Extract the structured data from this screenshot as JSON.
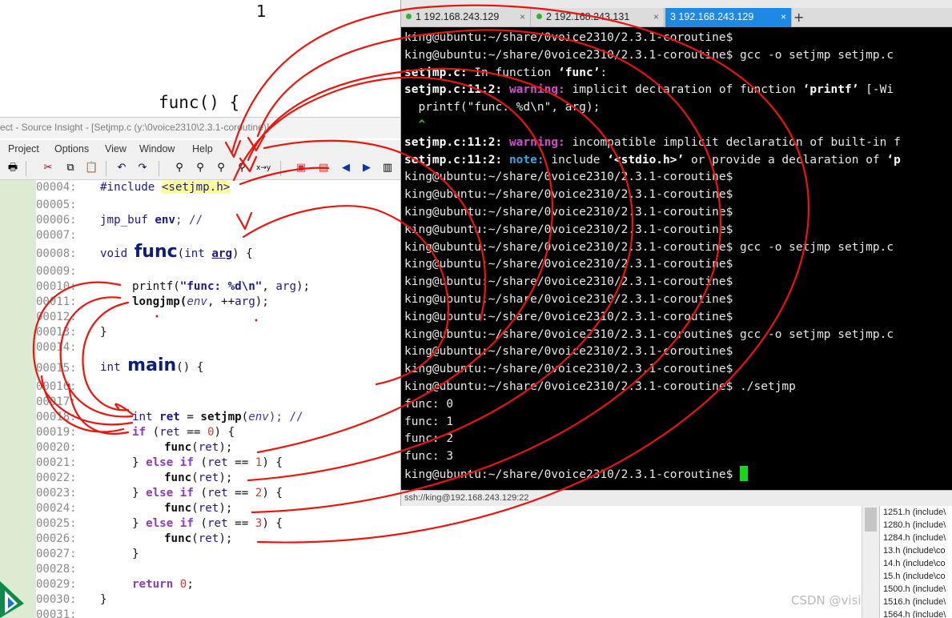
{
  "whiteboard": {
    "one": "1",
    "func_label": "func() {"
  },
  "source_insight": {
    "title": "ect - Source Insight - [Setjmp.c (y:\\0voice2310\\2.3.1-coroutine)]",
    "menu": [
      "Project",
      "Options",
      "View",
      "Window",
      "Help"
    ],
    "line_numbers": [
      "00004:",
      "00005:",
      "00006:",
      "00007:",
      "00008:",
      "00009:",
      "00010:",
      "00011:",
      "00012:",
      "00013:",
      "00014:",
      "00015:",
      "00016:",
      "00017:",
      "00018:",
      "00019:",
      "00020:",
      "00021:",
      "00022:",
      "00023:",
      "00024:",
      "00025:",
      "00026:",
      "00027:",
      "00028:",
      "00029:",
      "00030:",
      "00031:"
    ],
    "code": {
      "l4_a": "#include ",
      "l4_b": "<setjmp.h>",
      "l6_a": "jmp_buf ",
      "l6_b": "env",
      "l6_c": "; //",
      "l8_a": "void ",
      "l8_b": "func",
      "l8_c": "(",
      "l8_d": "int ",
      "l8_e": "arg",
      "l8_f": ") {",
      "l10_a": "printf(",
      "l10_b": "\"func: %d\\n\"",
      "l10_c": ", ",
      "l10_d": "arg",
      "l10_e": ");",
      "l11_a": "longjmp(",
      "l11_b": "env",
      "l11_c": ", ++",
      "l11_d": "arg",
      "l11_e": ");",
      "l13": "}",
      "l15_a": "int ",
      "l15_b": "main",
      "l15_c": "() {",
      "l18_a": "int ",
      "l18_b": "ret",
      "l18_c": " = ",
      "l18_d": "setjmp",
      "l18_e": "(",
      "l18_f": "env",
      "l18_g": "); //",
      "l19_a": "if",
      "l19_b": " (",
      "l19_c": "ret",
      "l19_d": " == ",
      "l19_e": "0",
      "l19_f": ") {",
      "l20_a": "func",
      "l20_b": "(",
      "l20_c": "ret",
      "l20_d": ");",
      "l21_a": "} ",
      "l21_b": "else if",
      "l21_c": " (",
      "l21_d": "ret",
      "l21_e": " == ",
      "l21_f": "1",
      "l21_g": ") {",
      "l22_a": "func",
      "l22_b": "(",
      "l22_c": "ret",
      "l22_d": ");",
      "l23_a": "} ",
      "l23_b": "else if",
      "l23_c": " (",
      "l23_d": "ret",
      "l23_e": " == ",
      "l23_f": "2",
      "l23_g": ") {",
      "l24_a": "func",
      "l24_b": "(",
      "l24_c": "ret",
      "l24_d": ");",
      "l25_a": "} ",
      "l25_b": "else if",
      "l25_c": " (",
      "l25_d": "ret",
      "l25_e": " == ",
      "l25_f": "3",
      "l25_g": ") {",
      "l26_a": "func",
      "l26_b": "(",
      "l26_c": "ret",
      "l26_d": ");",
      "l27": "}",
      "l29_a": "return ",
      "l29_b": "0",
      "l29_c": ";",
      "l30": "}"
    }
  },
  "terminal": {
    "tabs": [
      {
        "label": "1 192.168.243.129",
        "status_color": "#2db52d"
      },
      {
        "label": "2 192.168.243.131",
        "status_color": "#2db52d"
      },
      {
        "label": "3 192.168.243.129",
        "status_color": "#ffffff"
      }
    ],
    "tab_close": "×",
    "tab_add": "+",
    "prompt": "king@ubuntu:~/share/0voice2310/2.3.1-coroutine$",
    "cmd_gcc": " gcc -o setjmp setjmp.c",
    "cmd_run": " ./setjmp",
    "w1_file": "setjmp.c:",
    "w1_msg": " In function ",
    "w1_fn": "‘func’",
    "w1_end": ":",
    "w2_loc": "setjmp.c:11:2:",
    "w2_kind": " warning:",
    "w2_msg": " implicit declaration of function ",
    "w2_fn": "‘printf’",
    "w2_flag": " [-Wi",
    "w2_code": "  printf(\"func: %d\\n\", arg);",
    "w2_caret": "  ^",
    "w3_loc": "setjmp.c:11:2:",
    "w3_kind": " warning:",
    "w3_msg": " incompatible implicit declaration of built-in f",
    "w4_loc": "setjmp.c:11:2:",
    "w4_kind": " note:",
    "w4_msg": " include ",
    "w4_hdr": "‘<stdio.h>’",
    "w4_msg2": " or provide a declaration of ",
    "w4_end": "‘p",
    "out": [
      "func: 0",
      "func: 1",
      "func: 2",
      "func: 3"
    ],
    "status": "ssh://king@192.168.243.129:22"
  },
  "file_list": [
    "1251.h (include\\",
    "1280.h (include\\",
    "1284.h (include\\",
    "13.h (include\\co",
    "14.h (include\\co",
    "15.h (include\\co",
    "1500.h (include\\",
    "1516.h (include\\",
    "1564.h (include\\"
  ],
  "watermark": "CSDN @visi"
}
